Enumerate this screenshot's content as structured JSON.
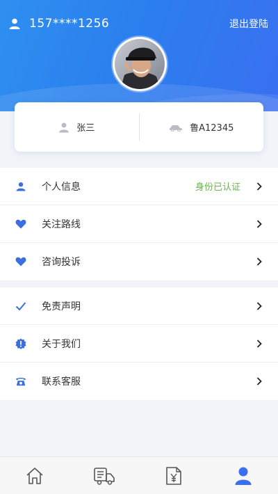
{
  "header": {
    "phone": "157****1256",
    "logout_label": "退出登陆"
  },
  "profile_card": {
    "name": "张三",
    "plate": "鲁A12345"
  },
  "menu_group_1": [
    {
      "label": "个人信息",
      "status": "身份已认证",
      "icon": "person-icon"
    },
    {
      "label": "关注路线",
      "icon": "heart-icon"
    },
    {
      "label": "咨询投诉",
      "icon": "heart-icon"
    }
  ],
  "menu_group_2": [
    {
      "label": "免责声明",
      "icon": "check-icon"
    },
    {
      "label": "关于我们",
      "icon": "badge-alert-icon"
    },
    {
      "label": "联系客服",
      "icon": "telephone-icon"
    }
  ],
  "tabbar": {
    "tabs": [
      "home-icon",
      "truck-icon",
      "receipt-yen-icon",
      "user-icon"
    ],
    "active_index": 3
  },
  "colors": {
    "accent": "#3a6ff0",
    "header_start": "#2f8ff0",
    "status_green": "#6bb34a",
    "icon_blue": "#3b6fe0"
  }
}
